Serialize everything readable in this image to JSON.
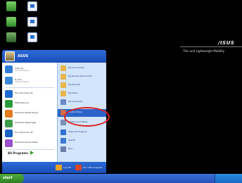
{
  "desktop": {
    "icons": [
      {
        "name": "my-computer-icon",
        "label": ""
      },
      {
        "name": "document-icon",
        "label": ""
      },
      {
        "name": "recycle-icon",
        "label": ""
      },
      {
        "name": "folder-icon",
        "label": ""
      },
      {
        "name": "network-icon",
        "label": ""
      },
      {
        "name": "folder-icon-2",
        "label": ""
      }
    ]
  },
  "brand": {
    "logo": "/ISUS",
    "tagline": "Thin and Lightweight Mobility"
  },
  "start_menu": {
    "user": "ASUS",
    "pinned": [
      {
        "label": "Internet",
        "sub": "Internet Explorer",
        "icon": "internet-explorer-icon",
        "color": "#2f7ad8"
      },
      {
        "label": "E-mail",
        "sub": "Outlook Express",
        "icon": "email-icon",
        "color": "#3a86d6"
      }
    ],
    "recent": [
      {
        "label": "Tour Windows XP",
        "icon": "windows-tour-icon",
        "color": "#1e6ad0"
      },
      {
        "label": "MSN Explorer",
        "icon": "msn-icon",
        "color": "#2a9a3d"
      },
      {
        "label": "Windows Media Player",
        "icon": "media-player-icon",
        "color": "#e17a1c"
      },
      {
        "label": "Windows Messenger",
        "icon": "messenger-icon",
        "color": "#3d9b4a"
      },
      {
        "label": "Tour Windows XP",
        "icon": "tour-icon",
        "color": "#1b62c2"
      },
      {
        "label": "Windows Movie Maker",
        "icon": "movie-maker-icon",
        "color": "#9a4fd0"
      }
    ],
    "all_programs": "All Programs",
    "right": [
      {
        "label": "My Documents",
        "icon": "folder-icon",
        "color": "#e8b64a"
      },
      {
        "label": "My Recent Documents",
        "icon": "folder-icon",
        "color": "#e8b64a"
      },
      {
        "label": "My Pictures",
        "icon": "folder-icon",
        "color": "#e8b64a"
      },
      {
        "label": "My Music",
        "icon": "folder-icon",
        "color": "#e8b64a"
      },
      {
        "label": "My Computer",
        "icon": "computer-icon",
        "color": "#6b88c6"
      },
      {
        "label": "Control Panel",
        "icon": "control-panel-icon",
        "color": "#d06d4b"
      },
      {
        "label": "Printers and Faxes",
        "icon": "printer-icon",
        "color": "#7a8fb3"
      },
      {
        "label": "Help and Support",
        "icon": "help-icon",
        "color": "#2e6fd1"
      },
      {
        "label": "Search",
        "icon": "search-icon",
        "color": "#3c78d0"
      },
      {
        "label": "Run...",
        "icon": "run-icon",
        "color": "#6a7fa8"
      }
    ],
    "footer": {
      "log_off": "Log Off",
      "turn_off": "Turn Off Computer"
    }
  },
  "taskbar": {
    "start_label": "start"
  }
}
